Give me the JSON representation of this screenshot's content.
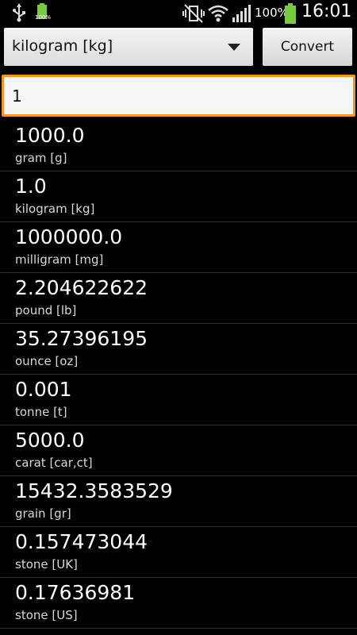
{
  "status_bar": {
    "small_battery_text": "100%",
    "battery_percent": "100%",
    "time": "16:01"
  },
  "toolbar": {
    "unit_selected": "kilogram [kg]",
    "convert_label": "Convert"
  },
  "input": {
    "value": "1"
  },
  "results": [
    {
      "value": "1000.0",
      "unit": "gram [g]"
    },
    {
      "value": "1.0",
      "unit": "kilogram [kg]"
    },
    {
      "value": "1000000.0",
      "unit": "milligram [mg]"
    },
    {
      "value": "2.204622622",
      "unit": "pound [lb]"
    },
    {
      "value": "35.27396195",
      "unit": "ounce [oz]"
    },
    {
      "value": "0.001",
      "unit": "tonne [t]"
    },
    {
      "value": "5000.0",
      "unit": "carat [car,ct]"
    },
    {
      "value": "15432.3583529",
      "unit": "grain [gr]"
    },
    {
      "value": "0.157473044",
      "unit": "stone [UK]"
    },
    {
      "value": "0.17636981",
      "unit": "stone [US]"
    }
  ],
  "icons": {
    "usb": "usb-icon",
    "battery_small": "battery-small-icon",
    "mute": "vibrate-mute-icon",
    "wifi": "wifi-icon",
    "signal": "signal-icon",
    "battery": "battery-icon",
    "dropdown": "chevron-down-icon"
  },
  "colors": {
    "accent": "#f7941d",
    "battery_green": "#7ac943",
    "background": "#000000"
  }
}
